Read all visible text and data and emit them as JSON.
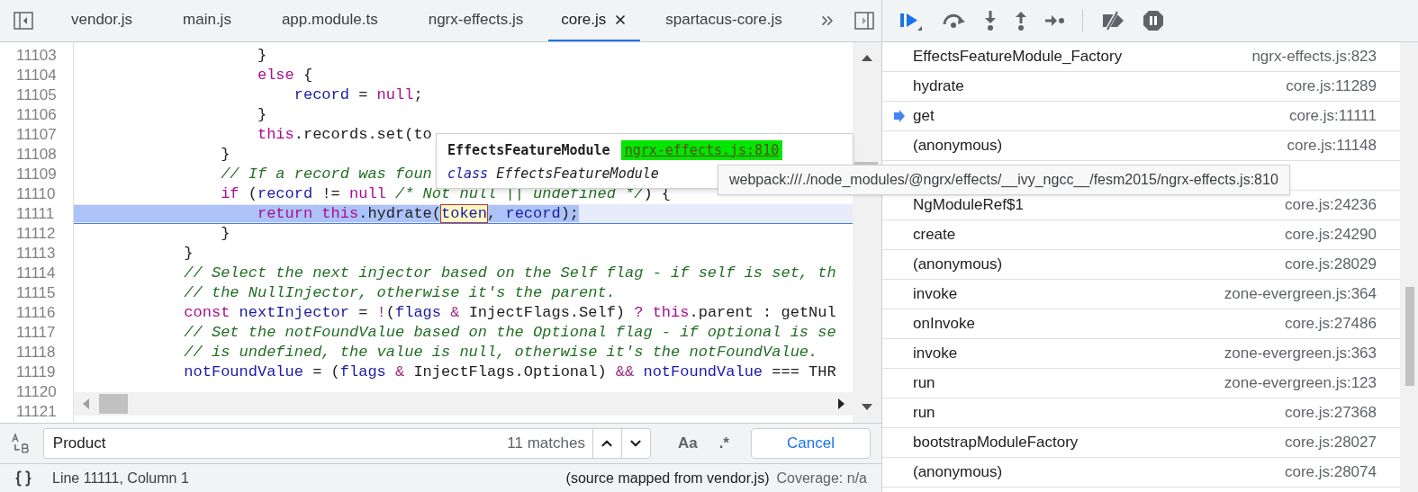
{
  "editor": {
    "tabs": [
      {
        "label": "vendor.js",
        "selected": false
      },
      {
        "label": "main.js",
        "selected": false
      },
      {
        "label": "app.module.ts",
        "selected": false
      },
      {
        "label": "ngrx-effects.js",
        "selected": false
      },
      {
        "label": "core.js",
        "selected": true
      },
      {
        "label": "spartacus-core.js",
        "selected": false
      }
    ],
    "lines": [
      {
        "number": "11103",
        "selected": false,
        "tokens": [
          {
            "text": "                    }",
            "kind": "plain"
          }
        ]
      },
      {
        "number": "11104",
        "selected": false,
        "tokens": [
          {
            "text": "                    else",
            "kind": "kw"
          },
          {
            "text": " {",
            "kind": "plain"
          }
        ]
      },
      {
        "number": "11105",
        "selected": false,
        "tokens": [
          {
            "text": "                        record",
            "kind": "var"
          },
          {
            "text": " = ",
            "kind": "plain"
          },
          {
            "text": "null",
            "kind": "kw"
          },
          {
            "text": ";",
            "kind": "plain"
          }
        ]
      },
      {
        "number": "11106",
        "selected": false,
        "tokens": [
          {
            "text": "                    }",
            "kind": "plain"
          }
        ]
      },
      {
        "number": "11107",
        "selected": false,
        "tokens": [
          {
            "text": "                    this",
            "kind": "kw"
          },
          {
            "text": ".records.set(to",
            "kind": "plain"
          }
        ]
      },
      {
        "number": "11108",
        "selected": false,
        "tokens": [
          {
            "text": "                }",
            "kind": "plain"
          }
        ]
      },
      {
        "number": "11109",
        "selected": false,
        "tokens": [
          {
            "text": "                // If a record was foun",
            "kind": "cm"
          }
        ]
      },
      {
        "number": "11110",
        "selected": false,
        "tokens": [
          {
            "text": "                if",
            "kind": "kw"
          },
          {
            "text": " (",
            "kind": "plain"
          },
          {
            "text": "record",
            "kind": "var"
          },
          {
            "text": " != ",
            "kind": "plain"
          },
          {
            "text": "null ",
            "kind": "kw"
          },
          {
            "text": "/* Not null || undefined */",
            "kind": "cm"
          },
          {
            "text": ") {",
            "kind": "plain"
          }
        ]
      },
      {
        "number": "11111",
        "selected": true,
        "tokens": [
          {
            "text": "                    return this",
            "kind": "kw"
          },
          {
            "text": ".hydrate(",
            "kind": "plain"
          },
          {
            "text": "token",
            "kind": "mark"
          },
          {
            "text": ", ",
            "kind": "plain"
          },
          {
            "text": "record",
            "kind": "var"
          },
          {
            "text": ");",
            "kind": "plain"
          }
        ]
      },
      {
        "number": "11112",
        "selected": false,
        "tokens": [
          {
            "text": "                }",
            "kind": "plain"
          }
        ]
      },
      {
        "number": "11113",
        "selected": false,
        "tokens": [
          {
            "text": "            }",
            "kind": "plain"
          }
        ]
      },
      {
        "number": "11114",
        "selected": false,
        "tokens": [
          {
            "text": "            // Select the next injector based on the Self flag - if self is set, th",
            "kind": "cm"
          }
        ]
      },
      {
        "number": "11115",
        "selected": false,
        "tokens": [
          {
            "text": "            // the NullInjector, otherwise it's the parent.",
            "kind": "cm"
          }
        ]
      },
      {
        "number": "11116",
        "selected": false,
        "tokens": [
          {
            "text": "            const",
            "kind": "kw"
          },
          {
            "text": " nextInjector",
            "kind": "var"
          },
          {
            "text": " = ",
            "kind": "plain"
          },
          {
            "text": "!",
            "kind": "op"
          },
          {
            "text": "(",
            "kind": "plain"
          },
          {
            "text": "flags",
            "kind": "var"
          },
          {
            "text": " & ",
            "kind": "op"
          },
          {
            "text": "InjectFlags.Self) ",
            "kind": "plain"
          },
          {
            "text": "? this",
            "kind": "kw"
          },
          {
            "text": ".parent : getNul",
            "kind": "plain"
          }
        ]
      },
      {
        "number": "11117",
        "selected": false,
        "tokens": [
          {
            "text": "            // Set the notFoundValue based on the Optional flag - if optional is se",
            "kind": "cm"
          }
        ]
      },
      {
        "number": "11118",
        "selected": false,
        "tokens": [
          {
            "text": "            // is undefined, the value is null, otherwise it's the notFoundValue.",
            "kind": "cm"
          }
        ]
      },
      {
        "number": "11119",
        "selected": false,
        "tokens": [
          {
            "text": "            notFoundValue",
            "kind": "var"
          },
          {
            "text": " = (",
            "kind": "plain"
          },
          {
            "text": "flags",
            "kind": "var"
          },
          {
            "text": " & ",
            "kind": "op"
          },
          {
            "text": "InjectFlags.Optional) ",
            "kind": "plain"
          },
          {
            "text": "&& ",
            "kind": "op"
          },
          {
            "text": "notFoundValue",
            "kind": "var"
          },
          {
            "text": " === THR",
            "kind": "plain"
          }
        ]
      },
      {
        "number": "11120"
      },
      {
        "number": "11121"
      }
    ],
    "tooltip": {
      "name": "EffectsFeatureModule",
      "link": "ngrx-effects.js:810",
      "keyword": "class",
      "signature": "EffectsFeatureModule"
    }
  },
  "path_tooltip": "webpack:///./node_modules/@ngrx/effects/__ivy_ngcc__/fesm2015/ngrx-effects.js:810",
  "search": {
    "value": "Product",
    "matches": "11 matches",
    "case_button": "Aa",
    "regex_button": ".*",
    "cancel_button": "Cancel"
  },
  "status_bar": {
    "position": "Line 11111, Column 1",
    "source_map": "(source mapped from vendor.js)",
    "coverage": "Coverage: n/a"
  },
  "call_stack": [
    {
      "kind": "frame",
      "name": "EffectsFeatureModule_Factory",
      "location": "ngrx-effects.js:823",
      "current": false
    },
    {
      "kind": "frame",
      "name": "hydrate",
      "location": "core.js:11289",
      "current": false
    },
    {
      "kind": "frame",
      "name": "get",
      "location": "core.js:11111",
      "current": true
    },
    {
      "kind": "frame",
      "name": "(anonymous)",
      "location": "core.js:11148",
      "current": false
    },
    {
      "kind": "covered"
    },
    {
      "kind": "frame",
      "name": "NgModuleRef$1",
      "location": "core.js:24236",
      "current": false
    },
    {
      "kind": "frame",
      "name": "create",
      "location": "core.js:24290",
      "current": false
    },
    {
      "kind": "frame",
      "name": "(anonymous)",
      "location": "core.js:28029",
      "current": false
    },
    {
      "kind": "frame",
      "name": "invoke",
      "location": "zone-evergreen.js:364",
      "current": false
    },
    {
      "kind": "frame",
      "name": "onInvoke",
      "location": "core.js:27486",
      "current": false
    },
    {
      "kind": "frame",
      "name": "invoke",
      "location": "zone-evergreen.js:363",
      "current": false
    },
    {
      "kind": "frame",
      "name": "run",
      "location": "zone-evergreen.js:123",
      "current": false
    },
    {
      "kind": "frame",
      "name": "run",
      "location": "core.js:27368",
      "current": false
    },
    {
      "kind": "frame",
      "name": "bootstrapModuleFactory",
      "location": "core.js:28027",
      "current": false
    },
    {
      "kind": "frame",
      "name": "(anonymous)",
      "location": "core.js:28074",
      "current": false
    }
  ]
}
